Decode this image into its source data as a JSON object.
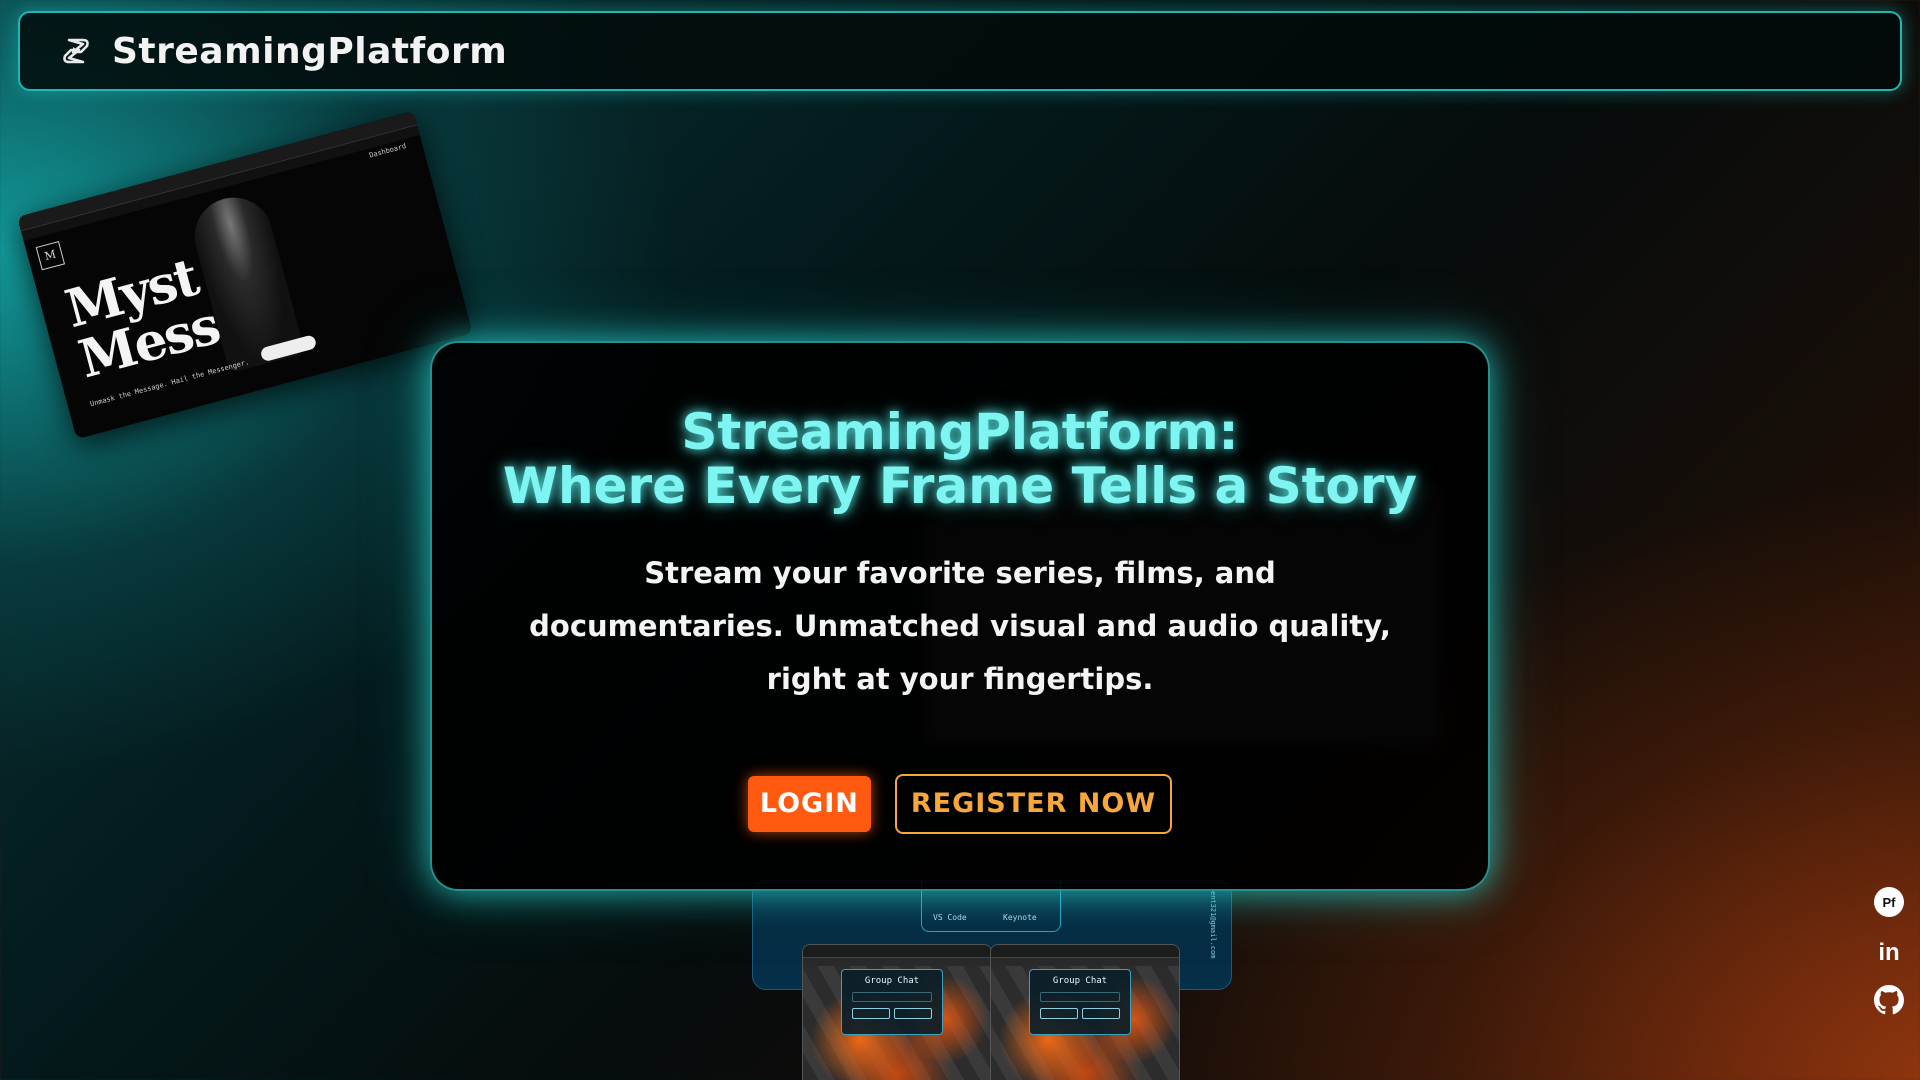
{
  "header": {
    "brand": "StreamingPlatform",
    "logo_icon": "streaming-logo-icon"
  },
  "hero": {
    "title_line1": "StreamingPlatform:",
    "title_line2": "Where Every Frame Tells a Story",
    "description_line1": "Stream your favorite series, films, and",
    "description_line2": "documentaries. Unmatched visual and audio quality,",
    "description_line3": "right at your fingertips.",
    "login_label": "LOGIN",
    "register_label": "REGISTER NOW"
  },
  "background_shots": {
    "mystery": {
      "line1": "Myst   y",
      "line2": "Mess   es",
      "logo_letter": "M",
      "tagline": "Unmask the Message. Hail the Messenger.",
      "dashboard": "Dashboard"
    },
    "tools": {
      "tile1": "VS Code",
      "tile2": "Keynote",
      "vertical_text": "ent321@gmail.com"
    },
    "chat": {
      "title": "Group Chat"
    }
  },
  "social": [
    {
      "name": "portfolio",
      "label": "Pf"
    },
    {
      "name": "linkedin",
      "label": "in"
    },
    {
      "name": "github",
      "label": "github"
    }
  ],
  "colors": {
    "accent_cyan": "#7ff5f2",
    "border_cyan": "#1fb7b3",
    "login_orange": "#ff5a10",
    "register_amber": "#f8a83a"
  }
}
